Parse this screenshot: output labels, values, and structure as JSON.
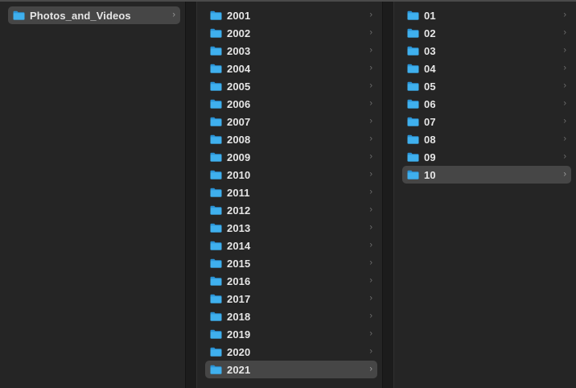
{
  "columns": [
    {
      "items": [
        {
          "label": "Photos_and_Videos",
          "selected": true
        }
      ]
    },
    {
      "items": [
        {
          "label": "2001"
        },
        {
          "label": "2002"
        },
        {
          "label": "2003"
        },
        {
          "label": "2004"
        },
        {
          "label": "2005"
        },
        {
          "label": "2006"
        },
        {
          "label": "2007"
        },
        {
          "label": "2008"
        },
        {
          "label": "2009"
        },
        {
          "label": "2010"
        },
        {
          "label": "2011"
        },
        {
          "label": "2012"
        },
        {
          "label": "2013"
        },
        {
          "label": "2014"
        },
        {
          "label": "2015"
        },
        {
          "label": "2016"
        },
        {
          "label": "2017"
        },
        {
          "label": "2018"
        },
        {
          "label": "2019"
        },
        {
          "label": "2020"
        },
        {
          "label": "2021",
          "selected": true
        }
      ]
    },
    {
      "items": [
        {
          "label": "01"
        },
        {
          "label": "02"
        },
        {
          "label": "03"
        },
        {
          "label": "04"
        },
        {
          "label": "05"
        },
        {
          "label": "06"
        },
        {
          "label": "07"
        },
        {
          "label": "08"
        },
        {
          "label": "09"
        },
        {
          "label": "10",
          "selected": true
        }
      ]
    }
  ],
  "icons": {
    "folder": "folder-icon",
    "chevron": "chevron-right-icon"
  },
  "colors": {
    "folder_body": "#3fb0ee",
    "folder_tab": "#2a93d6",
    "selection": "#464646",
    "text": "#e6e6e6"
  }
}
